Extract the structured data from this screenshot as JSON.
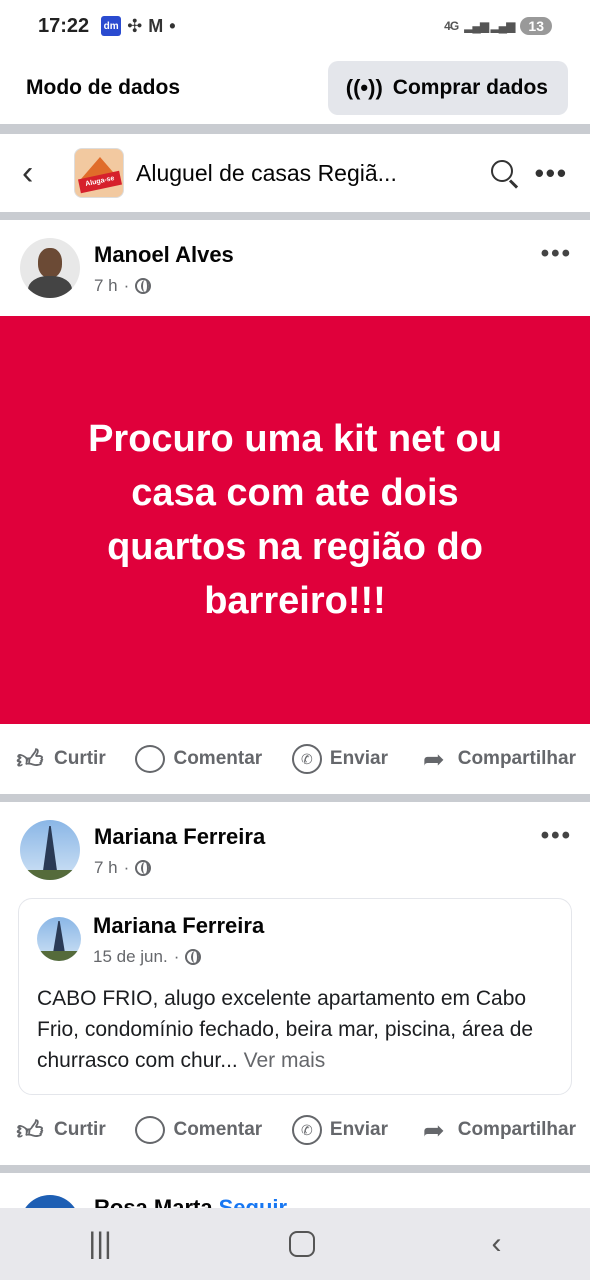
{
  "status_bar": {
    "time": "17:22",
    "notif_icons": [
      "dm-icon",
      "pinwheel-icon",
      "gmail-icon",
      "dot"
    ],
    "network": "4G",
    "battery": "13"
  },
  "data_bar": {
    "label": "Modo de dados",
    "buy_button": "Comprar dados"
  },
  "group_header": {
    "title": "Aluguel de casas Regiã...",
    "logo_text": "Aluga-se"
  },
  "posts": [
    {
      "author": "Manoel Alves",
      "time": "7 h",
      "text": "Procuro uma kit net ou casa com ate dois quartos na região do barreiro!!!",
      "background": "#e0003b"
    },
    {
      "author": "Mariana Ferreira",
      "time": "7 h",
      "shared": {
        "author": "Mariana Ferreira",
        "time": "15 de jun.",
        "text": "CABO FRIO, alugo excelente apartamento em Cabo Frio, condomínio fechado, beira mar, piscina, área de churrasco com chur...",
        "more": "Ver mais"
      }
    }
  ],
  "actions": {
    "like": "Curtir",
    "comment": "Comentar",
    "send": "Enviar",
    "share": "Compartilhar"
  },
  "next_post": {
    "author": "Rosa Marta",
    "follow": "Seguir"
  }
}
